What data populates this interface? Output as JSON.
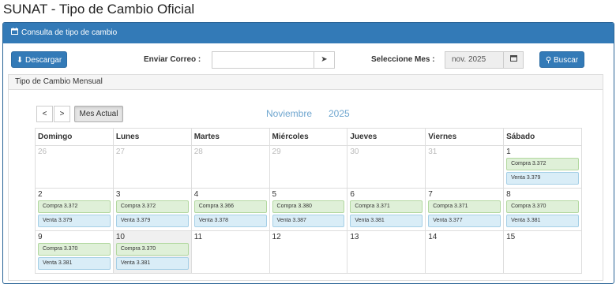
{
  "page_title": "SUNAT - Tipo de Cambio Oficial",
  "panel": {
    "title": "Consulta de tipo de cambio",
    "icon": "calendar-icon"
  },
  "toolbar": {
    "download_label": "Descargar",
    "email_label": "Enviar Correo :",
    "email_value": "",
    "month_label": "Seleccione Mes :",
    "month_value": "nov. 2025",
    "search_label": "Buscar"
  },
  "inner_title": "Tipo de Cambio Mensual",
  "calendar": {
    "prev": "<",
    "next": ">",
    "current_month_button": "Mes Actual",
    "month_name": "Noviembre",
    "year": "2025",
    "weekdays": [
      "Domingo",
      "Lunes",
      "Martes",
      "Miércoles",
      "Jueves",
      "Viernes",
      "Sábado"
    ],
    "weeks": [
      [
        {
          "day": "26",
          "other": true
        },
        {
          "day": "27",
          "other": true
        },
        {
          "day": "28",
          "other": true
        },
        {
          "day": "29",
          "other": true
        },
        {
          "day": "30",
          "other": true
        },
        {
          "day": "31",
          "other": true
        },
        {
          "day": "1",
          "buy": "Compra 3.372",
          "sell": "Venta 3.379"
        }
      ],
      [
        {
          "day": "2",
          "buy": "Compra 3.372",
          "sell": "Venta 3.379"
        },
        {
          "day": "3",
          "buy": "Compra 3.372",
          "sell": "Venta 3.379"
        },
        {
          "day": "4",
          "buy": "Compra 3.366",
          "sell": "Venta 3.378"
        },
        {
          "day": "5",
          "buy": "Compra 3.380",
          "sell": "Venta 3.387"
        },
        {
          "day": "6",
          "buy": "Compra 3.371",
          "sell": "Venta 3.381"
        },
        {
          "day": "7",
          "buy": "Compra 3.371",
          "sell": "Venta 3.377"
        },
        {
          "day": "8",
          "buy": "Compra 3.370",
          "sell": "Venta 3.381"
        }
      ],
      [
        {
          "day": "9",
          "buy": "Compra 3.370",
          "sell": "Venta 3.381"
        },
        {
          "day": "10",
          "buy": "Compra 3.370",
          "sell": "Venta 3.381",
          "today": true
        },
        {
          "day": "11"
        },
        {
          "day": "12"
        },
        {
          "day": "13"
        },
        {
          "day": "14"
        },
        {
          "day": "15"
        }
      ]
    ]
  },
  "colors": {
    "primary": "#337ab7",
    "buy_bg": "#dff0d8",
    "sell_bg": "#d9edf7",
    "month_title": "#6fa6cf"
  }
}
